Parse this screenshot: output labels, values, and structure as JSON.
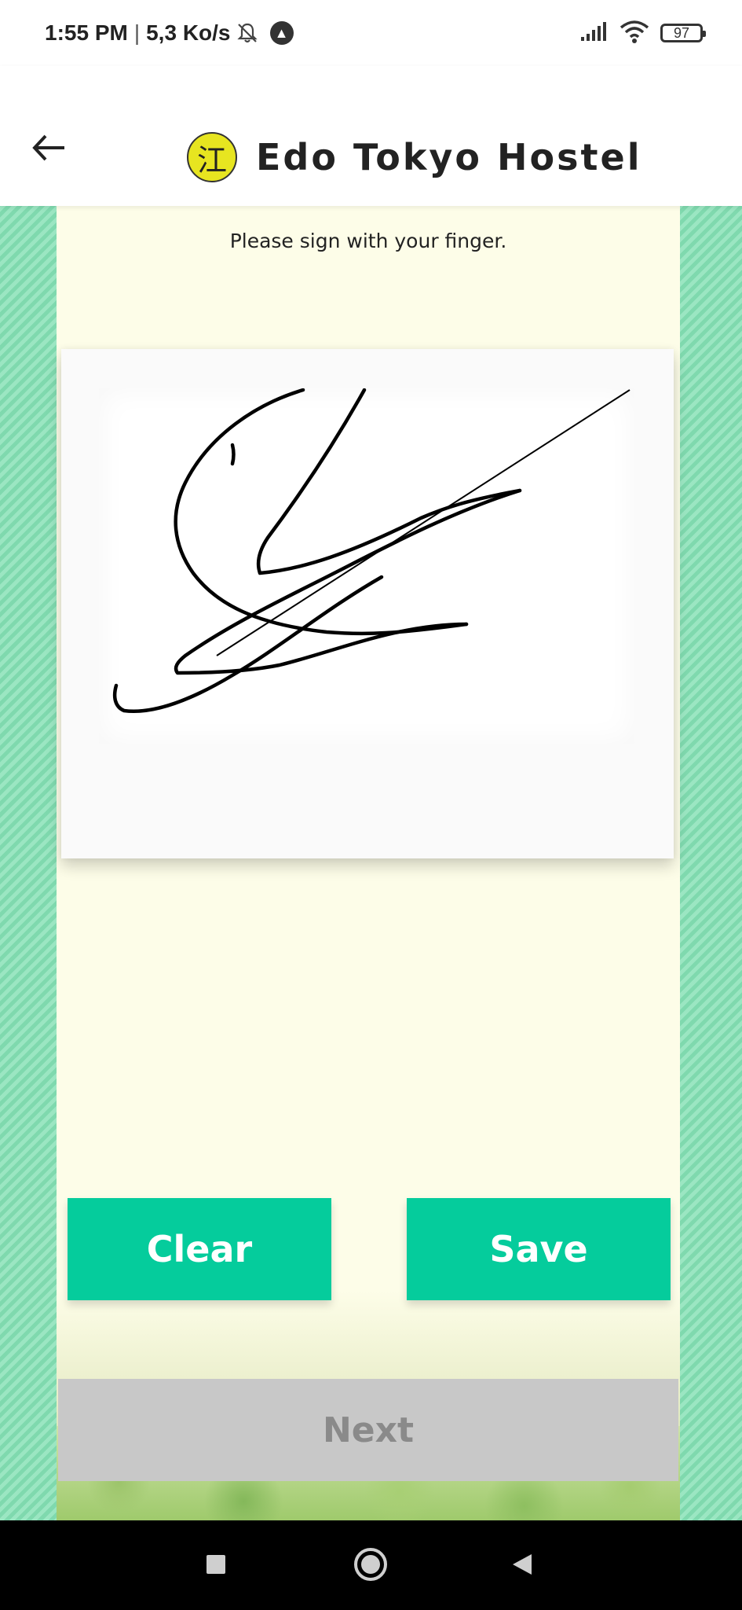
{
  "status_bar": {
    "time": "1:55 PM",
    "speed": "5,3 Ko/s",
    "battery": "97",
    "icons": [
      "mute-bell-icon",
      "app-notification-icon",
      "signal-icon",
      "wifi-icon",
      "battery-icon"
    ]
  },
  "header": {
    "title": "Edo Tokyo Hostel",
    "logo_glyph": "江",
    "back_icon": "arrow-left-icon"
  },
  "signature": {
    "instruction": "Please sign with your finger."
  },
  "buttons": {
    "clear_label": "Clear",
    "save_label": "Save",
    "next_label": "Next"
  },
  "nav": {
    "items": [
      "recents-square-icon",
      "home-circle-icon",
      "back-triangle-icon"
    ]
  },
  "colors": {
    "accent": "#05cc9c",
    "stripes": "#7fd9ae",
    "panel": "#fdfde8",
    "logo": "#e7e520",
    "disabled": "#c8c8c8"
  }
}
